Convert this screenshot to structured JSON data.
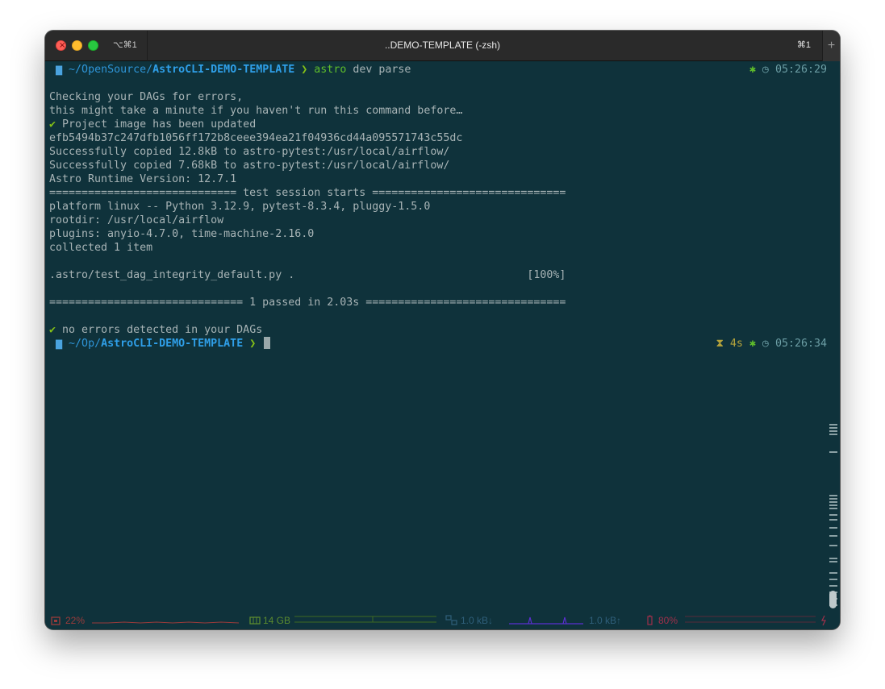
{
  "window": {
    "title": "..DEMO-TEMPLATE (-zsh)",
    "tab_shortcut_left": "⌥⌘1",
    "tab_shortcut_right": "⌘1",
    "new_tab_label": "+"
  },
  "prompt1": {
    "apple": "",
    "folder": "▆",
    "path_prefix": "~/OpenSource/",
    "path_current": "AstroCLI-DEMO-TEMPLATE",
    "chevron": "❯",
    "command": "astro",
    "args": "dev parse",
    "gear": "✱",
    "clock": "◷",
    "time": "05:26:29"
  },
  "output_lines": [
    "Checking your DAGs for errors,",
    "this might take a minute if you haven't run this command before…",
    "Project image has been updated",
    "efb5494b37c247dfb1056ff172b8ceee394ea21f04936cd44a095571743c55dc",
    "Successfully copied 12.8kB to astro-pytest:/usr/local/airflow/",
    "Successfully copied 7.68kB to astro-pytest:/usr/local/airflow/",
    "Astro Runtime Version: 12.7.1",
    "============================= test session starts ==============================",
    "platform linux -- Python 3.12.9, pytest-8.3.4, pluggy-1.5.0",
    "rootdir: /usr/local/airflow",
    "plugins: anyio-4.7.0, time-machine-2.16.0",
    "collected 1 item",
    ".astro/test_dag_integrity_default.py .                                    [100%]",
    "============================== 1 passed in 2.03s ===============================",
    "no errors detected in your DAGs"
  ],
  "check_mark": "✔",
  "prompt2": {
    "apple": "",
    "folder": "▆",
    "path_prefix": "~/Op/",
    "path_current": "AstroCLI-DEMO-TEMPLATE",
    "chevron": "❯",
    "hourglass": "⧗",
    "duration": "4s",
    "gear": "✱",
    "clock": "◷",
    "time": "05:26:34"
  },
  "status_bar": {
    "cpu": "22%",
    "memory": "14 GB",
    "net_down": "1.0 kB↓",
    "net_up": "1.0 kB↑",
    "battery": "80%",
    "colors": {
      "cpu": "#9a3b3b",
      "memory": "#5b8a2f",
      "network": "#2f5f7a",
      "battery": "#a0304a"
    }
  }
}
